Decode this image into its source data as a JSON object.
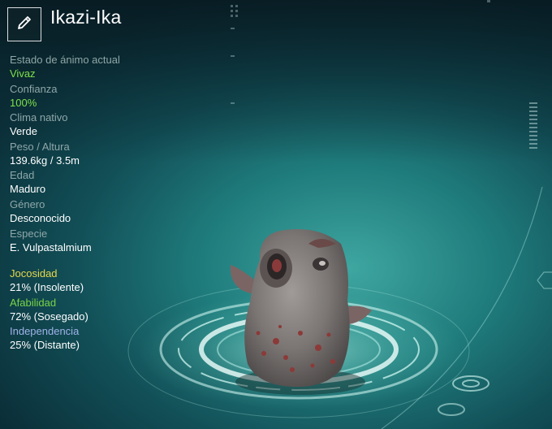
{
  "creature": {
    "name": "Ikazi-Ika",
    "edit_icon": "pencil-icon"
  },
  "stats": [
    {
      "label": "Estado de ánimo actual",
      "value": "Vivaz",
      "accent": "green"
    },
    {
      "label": "Confianza",
      "value": "100%",
      "accent": "green"
    },
    {
      "label": "Clima nativo",
      "value": "Verde",
      "accent": "white"
    },
    {
      "label": "Peso / Altura",
      "value": "139.6kg / 3.5m",
      "accent": "white"
    },
    {
      "label": "Edad",
      "value": "Maduro",
      "accent": "white"
    },
    {
      "label": "Género",
      "value": "Desconocido",
      "accent": "white"
    },
    {
      "label": "Especie",
      "value": "E. Vulpastalmium",
      "accent": "white"
    }
  ],
  "traits": [
    {
      "label": "Jocosidad",
      "value": "21% (Insolente)",
      "color": "#e6d84a"
    },
    {
      "label": "Afabilidad",
      "value": "72% (Sosegado)",
      "color": "#79d447"
    },
    {
      "label": "Independencia",
      "value": "25% (Distante)",
      "color": "#9fb3e8"
    }
  ],
  "colors": {
    "value_green": "#7de04a",
    "label_grey": "#8fa7a8"
  }
}
